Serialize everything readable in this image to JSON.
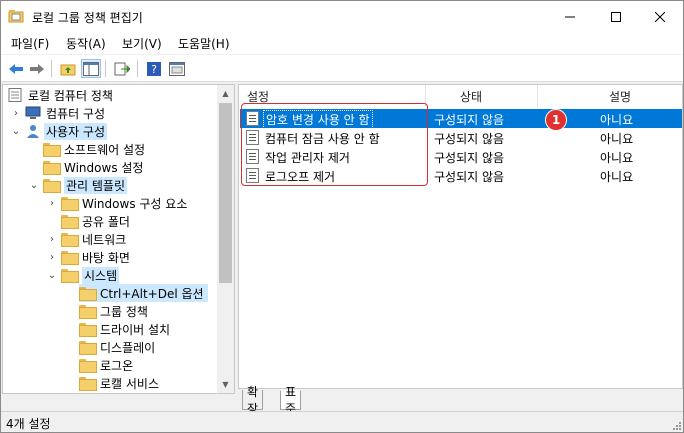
{
  "window": {
    "title": "로컬 그룹 정책 편집기"
  },
  "menu": [
    {
      "label": "파일(F)"
    },
    {
      "label": "동작(A)"
    },
    {
      "label": "보기(V)"
    },
    {
      "label": "도움말(H)"
    }
  ],
  "tree": [
    {
      "label": "로컬 컴퓨터 정책"
    },
    {
      "label": "컴퓨터 구성"
    },
    {
      "label": "사용자 구성"
    },
    {
      "label": "소프트웨어 설정"
    },
    {
      "label": "Windows 설정"
    },
    {
      "label": "관리 템플릿"
    },
    {
      "label": "Windows 구성 요소"
    },
    {
      "label": "공유 폴더"
    },
    {
      "label": "네트워크"
    },
    {
      "label": "바탕 화면"
    },
    {
      "label": "시스템"
    },
    {
      "label": "Ctrl+Alt+Del 옵션"
    },
    {
      "label": "그룹 정책"
    },
    {
      "label": "드라이버 설치"
    },
    {
      "label": "디스플레이"
    },
    {
      "label": "로그온"
    },
    {
      "label": "로캘 서비스"
    }
  ],
  "table": {
    "headers": [
      "설정",
      "상태",
      "설명"
    ],
    "rows": [
      {
        "setting": "암호 변경 사용 안 함",
        "state": "구성되지 않음",
        "desc": "아니요"
      },
      {
        "setting": "컴퓨터 잠금 사용 안 함",
        "state": "구성되지 않음",
        "desc": "아니요"
      },
      {
        "setting": "작업 관리자 제거",
        "state": "구성되지 않음",
        "desc": "아니요"
      },
      {
        "setting": "로그오프 제거",
        "state": "구성되지 않음",
        "desc": "아니요"
      }
    ]
  },
  "badge": "1",
  "tabs": [
    "확장",
    "표준"
  ],
  "status": "4개 설정",
  "colors": {
    "selection": "#0078d7",
    "tree_selection": "#cce8ff",
    "annotation": "#d03030"
  }
}
